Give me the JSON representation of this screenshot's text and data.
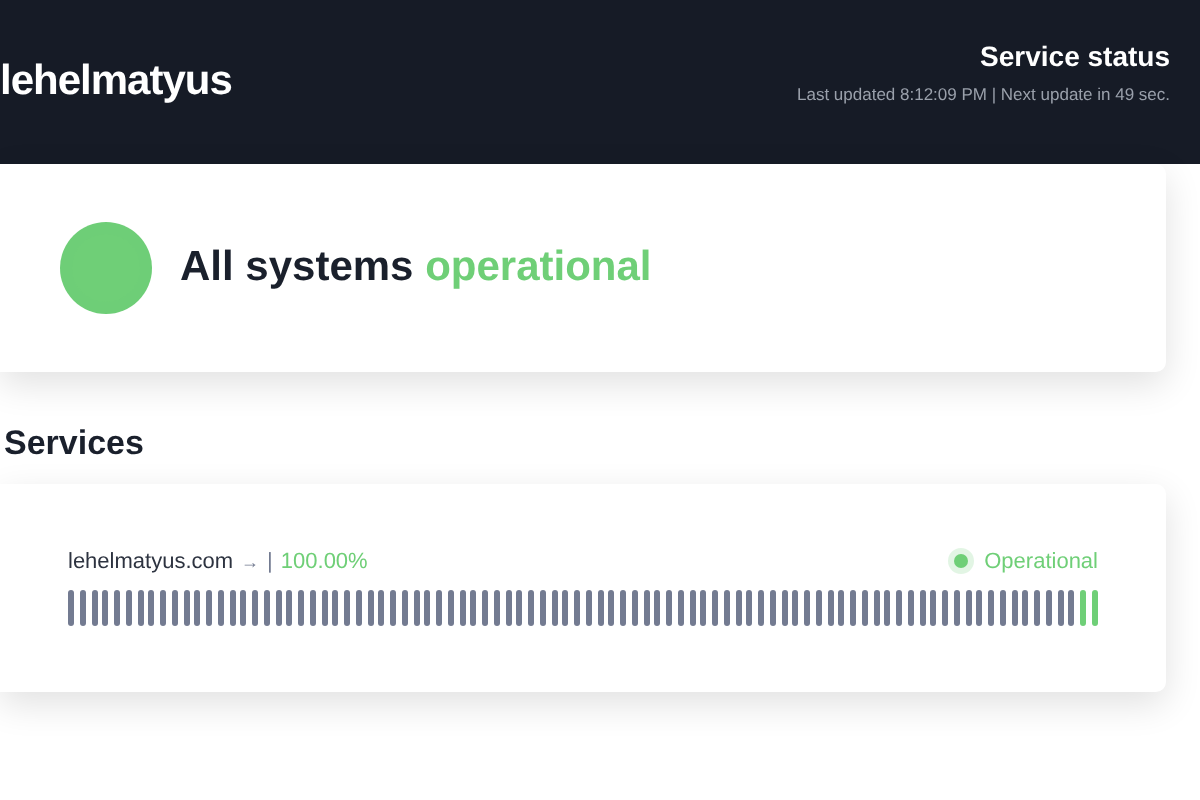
{
  "header": {
    "brand": "lehelmatyus",
    "title": "Service status",
    "subtitle": "Last updated 8:12:09 PM | Next update in 49 sec."
  },
  "overall": {
    "prefix": "All systems",
    "status": "operational",
    "color": "#6fcf77"
  },
  "services_heading": "Services",
  "services": [
    {
      "name": "lehelmatyus.com",
      "arrow": "→",
      "separator": "|",
      "uptime": "100.00%",
      "status": "Operational",
      "color": "#6fcf77",
      "history": [
        {
          "color": "#737b91"
        },
        {
          "color": "#737b91"
        },
        {
          "color": "#737b91"
        },
        {
          "color": "#737b91"
        },
        {
          "color": "#737b91"
        },
        {
          "color": "#737b91"
        },
        {
          "color": "#737b91"
        },
        {
          "color": "#737b91"
        },
        {
          "color": "#737b91"
        },
        {
          "color": "#737b91"
        },
        {
          "color": "#737b91"
        },
        {
          "color": "#737b91"
        },
        {
          "color": "#737b91"
        },
        {
          "color": "#737b91"
        },
        {
          "color": "#737b91"
        },
        {
          "color": "#737b91"
        },
        {
          "color": "#737b91"
        },
        {
          "color": "#737b91"
        },
        {
          "color": "#737b91"
        },
        {
          "color": "#737b91"
        },
        {
          "color": "#737b91"
        },
        {
          "color": "#737b91"
        },
        {
          "color": "#737b91"
        },
        {
          "color": "#737b91"
        },
        {
          "color": "#737b91"
        },
        {
          "color": "#737b91"
        },
        {
          "color": "#737b91"
        },
        {
          "color": "#737b91"
        },
        {
          "color": "#737b91"
        },
        {
          "color": "#737b91"
        },
        {
          "color": "#737b91"
        },
        {
          "color": "#737b91"
        },
        {
          "color": "#737b91"
        },
        {
          "color": "#737b91"
        },
        {
          "color": "#737b91"
        },
        {
          "color": "#737b91"
        },
        {
          "color": "#737b91"
        },
        {
          "color": "#737b91"
        },
        {
          "color": "#737b91"
        },
        {
          "color": "#737b91"
        },
        {
          "color": "#737b91"
        },
        {
          "color": "#737b91"
        },
        {
          "color": "#737b91"
        },
        {
          "color": "#737b91"
        },
        {
          "color": "#737b91"
        },
        {
          "color": "#737b91"
        },
        {
          "color": "#737b91"
        },
        {
          "color": "#737b91"
        },
        {
          "color": "#737b91"
        },
        {
          "color": "#737b91"
        },
        {
          "color": "#737b91"
        },
        {
          "color": "#737b91"
        },
        {
          "color": "#737b91"
        },
        {
          "color": "#737b91"
        },
        {
          "color": "#737b91"
        },
        {
          "color": "#737b91"
        },
        {
          "color": "#737b91"
        },
        {
          "color": "#737b91"
        },
        {
          "color": "#737b91"
        },
        {
          "color": "#737b91"
        },
        {
          "color": "#737b91"
        },
        {
          "color": "#737b91"
        },
        {
          "color": "#737b91"
        },
        {
          "color": "#737b91"
        },
        {
          "color": "#737b91"
        },
        {
          "color": "#737b91"
        },
        {
          "color": "#737b91"
        },
        {
          "color": "#737b91"
        },
        {
          "color": "#737b91"
        },
        {
          "color": "#737b91"
        },
        {
          "color": "#737b91"
        },
        {
          "color": "#737b91"
        },
        {
          "color": "#737b91"
        },
        {
          "color": "#737b91"
        },
        {
          "color": "#737b91"
        },
        {
          "color": "#737b91"
        },
        {
          "color": "#737b91"
        },
        {
          "color": "#737b91"
        },
        {
          "color": "#737b91"
        },
        {
          "color": "#737b91"
        },
        {
          "color": "#737b91"
        },
        {
          "color": "#737b91"
        },
        {
          "color": "#737b91"
        },
        {
          "color": "#737b91"
        },
        {
          "color": "#737b91"
        },
        {
          "color": "#737b91"
        },
        {
          "color": "#737b91"
        },
        {
          "color": "#737b91"
        },
        {
          "color": "#6fcf77"
        },
        {
          "color": "#6fcf77"
        }
      ]
    }
  ]
}
